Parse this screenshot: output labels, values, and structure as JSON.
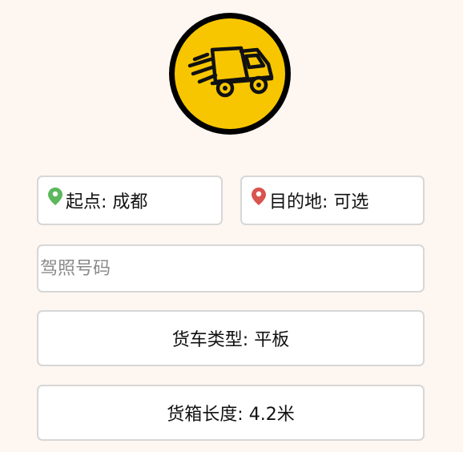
{
  "logo": {
    "icon": "delivery-truck-icon",
    "colors": {
      "ring": "#000000",
      "fill": "#f7c600"
    }
  },
  "origin": {
    "label": "起点: 成都",
    "icon": "map-pin-icon",
    "pin_color": "#5cb85c"
  },
  "destination": {
    "label": "目的地: 可选",
    "icon": "map-pin-icon",
    "pin_color": "#d9534f"
  },
  "license": {
    "placeholder": "驾照号码",
    "value": ""
  },
  "truck_type": {
    "label": "货车类型: 平板"
  },
  "box_length": {
    "label": "货箱长度: 4.2米"
  },
  "colors": {
    "background": "#fdf6f1",
    "field_border": "#d7d7d7"
  }
}
